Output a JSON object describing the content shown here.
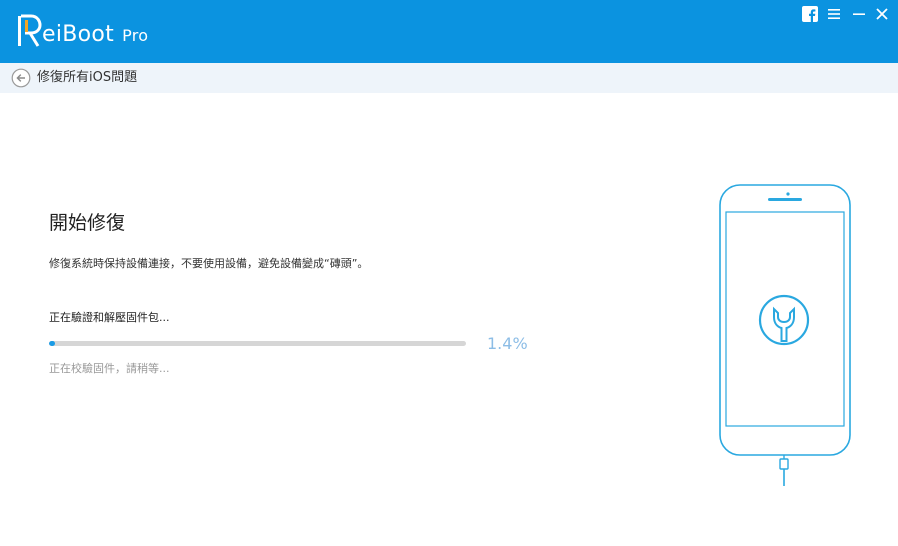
{
  "app": {
    "name": "eiBoot",
    "edition": "Pro",
    "accent_color": "#0b93e0"
  },
  "window_controls": {
    "facebook_icon": "facebook-icon",
    "menu_icon": "menu-icon",
    "minimize_icon": "minimize-icon",
    "close_icon": "close-icon"
  },
  "subbar": {
    "back_icon": "back-arrow-icon",
    "title": "修復所有iOS問題"
  },
  "main": {
    "heading": "開始修復",
    "description": "修復系統時保持設備連接，不要使用設備，避免設備變成“磚頭”。",
    "status": "正在驗證和解壓固件包...",
    "progress_percent": 1.4,
    "progress_label": "1.4%",
    "substatus": "正在校驗固件，請稍等..."
  },
  "illustration": {
    "icon": "phone-wrench-icon",
    "color": "#2aa8e0"
  }
}
